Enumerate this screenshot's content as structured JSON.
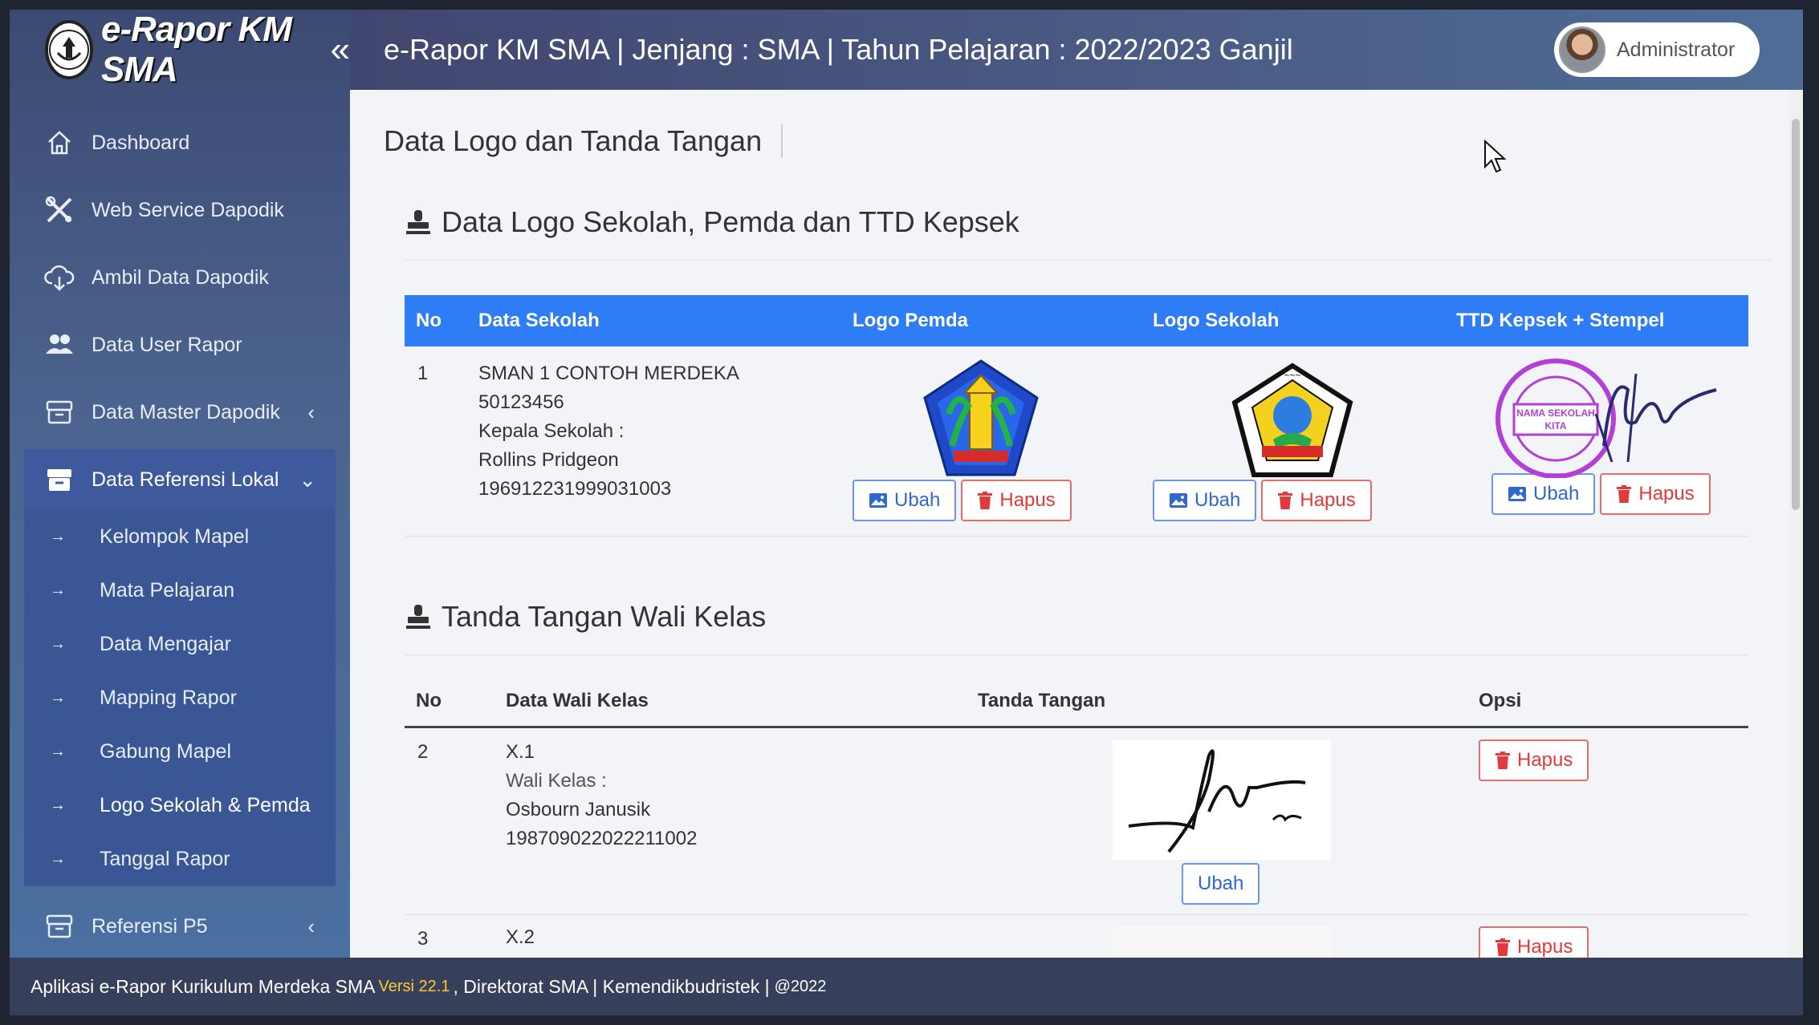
{
  "brand": {
    "title": "e-Rapor KM SMA"
  },
  "topbar": {
    "title": "e-Rapor KM SMA | Jenjang : SMA | Tahun Pelajaran : 2022/2023 Ganjil",
    "user": "Administrator"
  },
  "sidebar": {
    "items": [
      {
        "label": "Dashboard",
        "icon": "home-icon"
      },
      {
        "label": "Web Service Dapodik",
        "icon": "tools-icon"
      },
      {
        "label": "Ambil Data Dapodik",
        "icon": "cloud-download-icon"
      },
      {
        "label": "Data User Rapor",
        "icon": "users-icon"
      },
      {
        "label": "Data Master Dapodik",
        "icon": "archive-icon"
      }
    ],
    "group": {
      "label": "Data Referensi Lokal",
      "subitems": [
        "Kelompok Mapel",
        "Mata Pelajaran",
        "Data Mengajar",
        "Mapping Rapor",
        "Gabung Mapel",
        "Logo Sekolah & Pemda",
        "Tanggal Rapor"
      ]
    },
    "after": {
      "label": "Referensi P5"
    }
  },
  "main": {
    "page_title": "Data Logo dan Tanda Tangan",
    "section1": {
      "title": "Data Logo Sekolah, Pemda dan TTD Kepsek",
      "headers": [
        "No",
        "Data Sekolah",
        "Logo Pemda",
        "Logo Sekolah",
        "TTD Kepsek + Stempel"
      ],
      "row": {
        "no": "1",
        "school": "SMAN 1 CONTOH MERDEKA",
        "npsn": "50123456",
        "kepsek_label": "Kepala Sekolah :",
        "kepsek_name": "Rollins Pridgeon",
        "nip": "196912231999031003"
      },
      "stamp_text": "NAMA SEKOLAH KITA",
      "ubah": "Ubah",
      "hapus": "Hapus"
    },
    "section2": {
      "title": "Tanda Tangan Wali Kelas",
      "headers": [
        "No",
        "Data Wali Kelas",
        "Tanda Tangan",
        "Opsi"
      ],
      "rows": [
        {
          "no": "2",
          "kelas": "X.1",
          "wali_label": "Wali Kelas :",
          "wali_name": "Osbourn Janusik",
          "nip": "198709022022211002"
        },
        {
          "no": "3",
          "kelas": "X.2"
        }
      ],
      "ubah": "Ubah",
      "hapus": "Hapus"
    }
  },
  "footer": {
    "text": "Aplikasi e-Rapor Kurikulum Merdeka SMA",
    "version": "Versi 22.1",
    "org": ", Direktorat SMA | Kemendikbudristek |",
    "year": "@2022"
  },
  "colors": {
    "header_blue": "#2e7df6",
    "sidebar": "#4a6fa0",
    "topbar": "#41466f",
    "danger": "#e03a3a",
    "primary": "#2e68d0",
    "version": "#ffc936"
  }
}
